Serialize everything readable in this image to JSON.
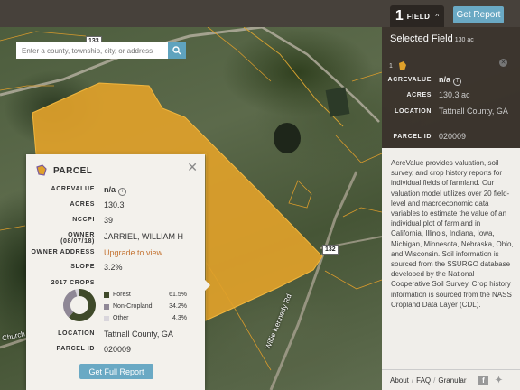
{
  "topbar": {
    "field_count": "1",
    "field_label": "FIELD",
    "report_button": "Get Report"
  },
  "search": {
    "placeholder": "Enter a county, township, city, or address"
  },
  "map": {
    "shields": [
      "133",
      "132"
    ],
    "road_labels": [
      "Church R",
      "Willie Kennedy Rd"
    ]
  },
  "parcel": {
    "title": "PARCEL",
    "rows": [
      {
        "key": "ACREVALUE",
        "value": "n/a"
      },
      {
        "key": "ACRES",
        "value": "130.3"
      },
      {
        "key": "NCCPI",
        "value": "39"
      },
      {
        "key": "OWNER",
        "key_sub": "(08/07/18)",
        "value": "JARRIEL, WILLIAM H"
      },
      {
        "key": "OWNER ADDRESS",
        "value": "Upgrade to view"
      },
      {
        "key": "SLOPE",
        "value": "3.2%"
      },
      {
        "key": "LOCATION",
        "value": "Tattnall County, GA"
      },
      {
        "key": "PARCEL ID",
        "value": "020009"
      }
    ],
    "crops_title": "2017 CROPS",
    "crops": [
      {
        "name": "Forest",
        "percent": "61.5%",
        "value": 61.5,
        "color": "#3f4a2a"
      },
      {
        "name": "Non-Cropland",
        "percent": "34.2%",
        "value": 34.2,
        "color": "#8f8896"
      },
      {
        "name": "Other",
        "percent": "4.3%",
        "value": 4.3,
        "color": "#d9d6dc"
      }
    ],
    "full_report_button": "Get Full Report"
  },
  "selected_field": {
    "title": "Selected Field",
    "acres_sub": "130 ac",
    "index": "1",
    "rows": [
      {
        "key": "ACREVALUE",
        "value": "n/a"
      },
      {
        "key": "ACRES",
        "value": "130.3 ac"
      },
      {
        "key": "LOCATION",
        "value": "Tattnall County, GA"
      },
      {
        "key": "PARCEL ID",
        "value": "020009"
      }
    ],
    "description": "AcreValue provides valuation, soil survey, and crop history reports for individual fields of farmland. Our valuation model utilizes over 20 field-level and macroeconomic data variables to estimate the value of an individual plot of farmland in California, Illinois, Indiana, Iowa, Michigan, Minnesota, Nebraska, Ohio, and Wisconsin. Soil information is sourced from the SSURGO database developed by the National Cooperative Soil Survey. Crop history information is sourced from the NASS Cropland Data Layer (CDL).",
    "footer": [
      "About",
      "FAQ",
      "Granular"
    ]
  },
  "colors": {
    "parcel_fill": "#e0a12a",
    "accent_button": "#6aa9c4",
    "link": "#c47433"
  }
}
